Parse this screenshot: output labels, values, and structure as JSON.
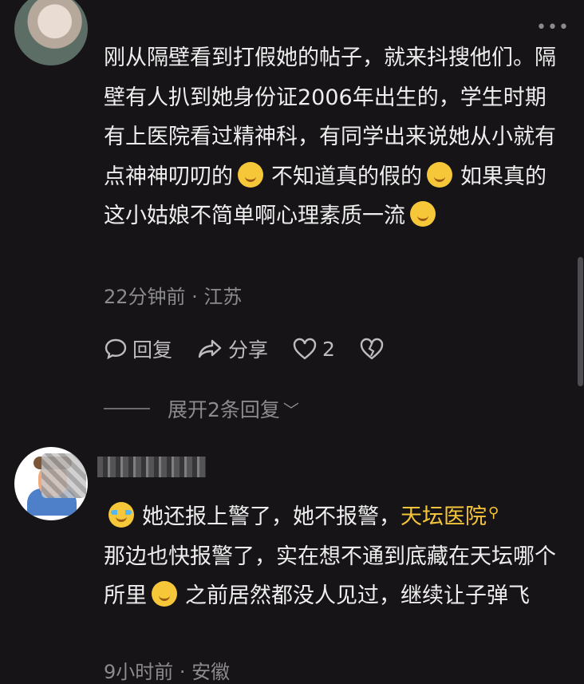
{
  "comment1": {
    "text_a": "刚从隔壁看到打假她的帖子，就来抖搜他们。隔壁有人扒到她身份证2006年出生的，学生时期有上医院看过精神科，有同学出来说她从小就有点神神叨叨的",
    "emoji_a": "laughing-crying-emoji",
    "text_b": "不知道真的假的",
    "emoji_b": "thinking-face-emoji",
    "text_c": "如果真的这小姑娘不简单啊心理素质一流",
    "emoji_c": "smirk-face-emoji",
    "time_location": "22分钟前 · 江苏",
    "reply_label": "回复",
    "share_label": "分享",
    "like_count": "2",
    "expand_replies": "展开2条回复",
    "more_icon": "•••"
  },
  "comment2": {
    "emoji_a": "crying-face-emoji",
    "text_a": "她还报上警了，她不报警，",
    "link": "天坛医院",
    "text_b": "那边也快报警了，实在想不通到底藏在天坛哪个所里",
    "emoji_b": "thinking-face-emoji",
    "text_c": "之前居然都没人见过，继续让子弹飞",
    "time_location": "9小时前 · 安徽"
  }
}
